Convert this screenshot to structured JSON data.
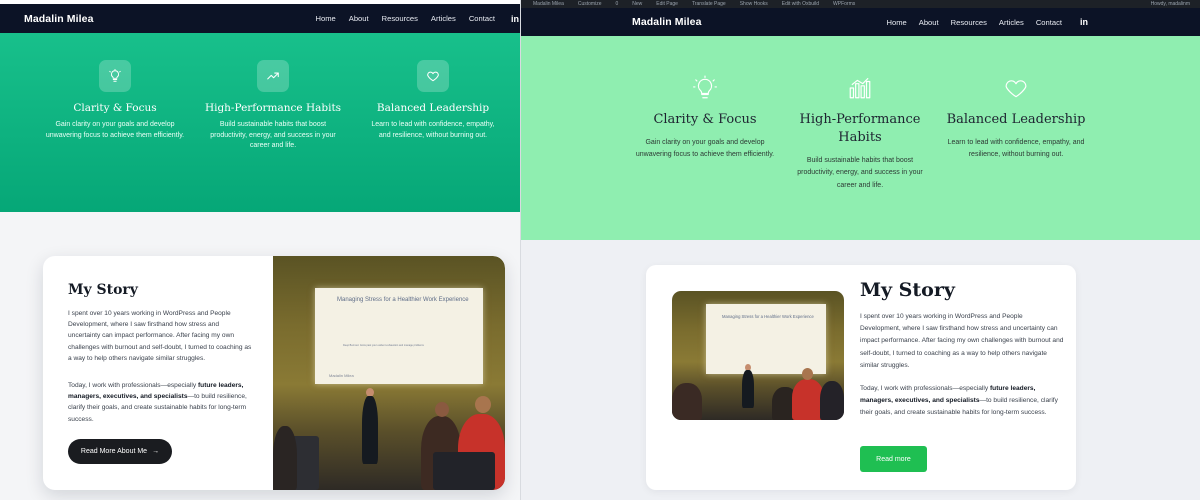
{
  "left": {
    "nav": {
      "brand": "Madalin Milea",
      "items": [
        "Home",
        "About",
        "Resources",
        "Articles",
        "Contact"
      ],
      "social_icon": "linkedin-icon",
      "social_label": "in"
    },
    "features": [
      {
        "icon": "lightbulb-icon",
        "title": "Clarity & Focus",
        "desc": "Gain clarity on your goals and develop unwavering focus to achieve them efficiently."
      },
      {
        "icon": "trending-up-icon",
        "title": "High-Performance Habits",
        "desc": "Build sustainable habits that boost productivity, energy, and success in your career and life."
      },
      {
        "icon": "heart-icon",
        "title": "Balanced Leadership",
        "desc": "Learn to lead with confidence, empathy, and resilience, without burning out."
      }
    ],
    "story": {
      "title": "My Story",
      "p1": "I spent over 10 years working in WordPress and People Development, where I saw firsthand how stress and uncertainty can impact performance. After facing my own challenges with burnout and self-doubt, I turned to coaching as a way to help others navigate similar struggles.",
      "p2_pre": "Today, I work with professionals—especially ",
      "p2_bold": "future leaders, managers, executives, and specialists",
      "p2_post": "—to build resilience, clarify their goals, and create sustainable habits for long-term success.",
      "button": "Read More About Me",
      "button_arrow": "→"
    },
    "photo": {
      "slide_title": "Managing Stress for a Healthier Work Experience",
      "slide_sub": "Deep Burnout: Grow past your evident exhaustion and manage problems",
      "slide_name": "Madalin Milea"
    },
    "colors": {
      "hero_top": "#18c08b",
      "hero_bottom": "#06a777",
      "nav": "#0c1326",
      "button": "#1a1c20"
    }
  },
  "right": {
    "adminbar": [
      "Madalin Milea",
      "Customize",
      "0",
      "New",
      "Edit Page",
      "Translate Page",
      "Show Hooks",
      "Edit with Oxbuild",
      "WPForms",
      "Howdy, madalinm"
    ],
    "nav": {
      "brand": "Madalin Milea",
      "items": [
        "Home",
        "About",
        "Resources",
        "Articles",
        "Contact"
      ],
      "social_icon": "linkedin-icon",
      "social_label": "in"
    },
    "features": [
      {
        "icon": "lightbulb-icon",
        "title": "Clarity & Focus",
        "desc": "Gain clarity on your goals and develop unwavering focus to achieve them efficiently."
      },
      {
        "icon": "bar-chart-icon",
        "title": "High-Performance Habits",
        "desc": "Build sustainable habits that boost productivity, energy, and success in your career and life."
      },
      {
        "icon": "heart-icon",
        "title": "Balanced Leadership",
        "desc": "Learn to lead with confidence, empathy, and resilience, without burning out."
      }
    ],
    "story": {
      "title": "My Story",
      "p1": "I spent over 10 years working in WordPress and People Development, where I saw firsthand how stress and uncertainty can impact performance. After facing my own challenges with burnout and self-doubt, I turned to coaching as a way to help others navigate similar struggles.",
      "p2_pre": "Today, I work with professionals—especially ",
      "p2_bold": "future leaders, managers, executives, and specialists",
      "p2_post": "—to build resilience, clarify their goals, and create sustainable habits for long-term success.",
      "button": "Read more"
    },
    "photo": {
      "slide_title": "Managing Stress for a Healthier Work Experience"
    },
    "colors": {
      "hero": "#8feeb0",
      "nav": "#0c1326",
      "button": "#1fbf52"
    }
  }
}
